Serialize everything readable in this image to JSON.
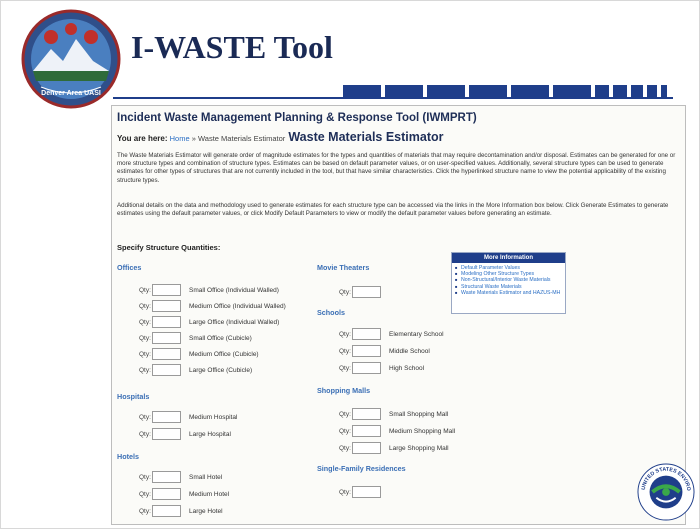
{
  "slide": {
    "title": "I-WASTE Tool",
    "seal_text": "Denver Area UASI",
    "epa_text": "UNITED STATES ENVIRONMENTAL PROTECTION"
  },
  "webpage": {
    "app_title": "Incident Waste Management Planning & Response Tool (IWMPRT)",
    "breadcrumb": {
      "prefix": "You are here:",
      "home": "Home",
      "separator": " » ",
      "current": "Waste Materials Estimator"
    },
    "page_heading": "Waste Materials Estimator",
    "intro_paragraph": "The Waste Materials Estimator will generate order of magnitude estimates for the types and quantities of materials that may require decontamination and/or disposal. Estimates can be generated for one or more structure types and combination of structure types. Estimates can be based on default parameter values, or on user-specified values. Additionally, several structure types can be used to generate estimates for other types of structures that are not currently included in the tool, but that have similar characteristics. Click the hyperlinked structure name to view the potential applicability of the existing structure types.",
    "details_paragraph": "Additional details on the data and methodology used to generate estimates for each structure type can be accessed via the links in the More Information box below. Click Generate Estimates to generate estimates using the default parameter values, or click Modify Default Parameters to view or modify the default parameter values before generating an estimate.",
    "specify_label": "Specify Structure Quantities:",
    "qty_label": "Qty:",
    "sections": {
      "offices": {
        "heading": "Offices",
        "items": [
          "Small Office (Individual Walled)",
          "Medium Office (Individual Walled)",
          "Large Office (Individual Walled)",
          "Small Office (Cubicle)",
          "Medium Office (Cubicle)",
          "Large Office (Cubicle)"
        ]
      },
      "hospitals": {
        "heading": "Hospitals",
        "items": [
          "Medium Hospital",
          "Large Hospital"
        ]
      },
      "hotels": {
        "heading": "Hotels",
        "items": [
          "Small Hotel",
          "Medium Hotel",
          "Large Hotel"
        ]
      },
      "movie_theaters": {
        "heading": "Movie Theaters"
      },
      "schools": {
        "heading": "Schools",
        "items": [
          "Elementary School",
          "Middle School",
          "High School"
        ]
      },
      "shopping_malls": {
        "heading": "Shopping Malls",
        "items": [
          "Small Shopping Mall",
          "Medium Shopping Mall",
          "Large Shopping Mall"
        ]
      },
      "single_family": {
        "heading": "Single-Family Residences"
      }
    },
    "more_info": {
      "heading": "More Information",
      "links": [
        "Default Parameter Values",
        "Modeling Other Structure Types",
        "Non-Structural/Interior Waste Materials",
        "Structural Waste Materials",
        "Waste Materials Estimator and HAZUS-MH"
      ]
    }
  },
  "colors": {
    "title": "#1a2a55",
    "accent": "#1f3e8a",
    "link": "#2a6ec4",
    "section_heading": "#3b6fb5"
  }
}
